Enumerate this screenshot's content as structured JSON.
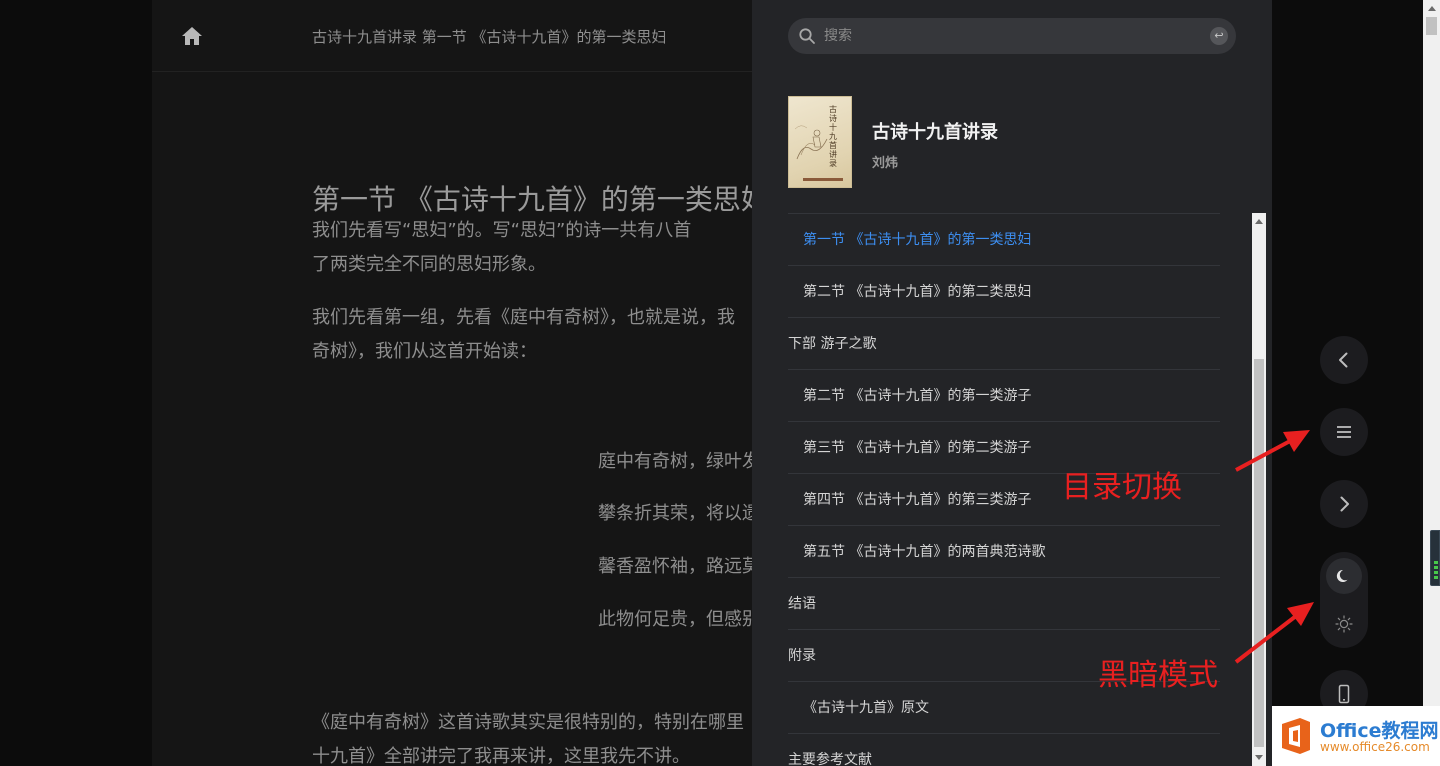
{
  "reader": {
    "breadcrumb": "古诗十九首讲录 第一节 《古诗十九首》的第一类思妇",
    "chapter_title": "第一节 《古诗十九首》的第一类思妇",
    "paragraphs": [
      "我们先看写“思妇”的。写“思妇”的诗一共有八首",
      "了两类完全不同的思妇形象。",
      "我们先看第一组，先看《庭中有奇树》，也就是说，我",
      "奇树》，我们从这首开始读："
    ],
    "poem_lines": [
      "庭中有奇树，绿叶发",
      "攀条折其荣，将以遗",
      "馨香盈怀袖，路远莫",
      "此物何足贵，但感别"
    ],
    "closing": [
      "《庭中有奇树》这首诗歌其实是很特别的，特别在哪里",
      "十九首》全部讲完了我再来讲，这里我先不讲。"
    ]
  },
  "drawer": {
    "search_placeholder": "搜索",
    "enter_glyph": "↩",
    "book": {
      "title": "古诗十九首讲录",
      "author": "刘炜",
      "cover_title": "古诗十九首讲录"
    },
    "toc": [
      {
        "label": "第一节 《古诗十九首》的第一类思妇",
        "level": 2,
        "active": true
      },
      {
        "label": "第二节 《古诗十九首》的第二类思妇",
        "level": 2,
        "active": false
      },
      {
        "label": "下部 游子之歌",
        "level": 1,
        "active": false
      },
      {
        "label": "第二节 《古诗十九首》的第一类游子",
        "level": 2,
        "active": false
      },
      {
        "label": "第三节 《古诗十九首》的第二类游子",
        "level": 2,
        "active": false
      },
      {
        "label": "第四节 《古诗十九首》的第三类游子",
        "level": 2,
        "active": false
      },
      {
        "label": "第五节 《古诗十九首》的两首典范诗歌",
        "level": 2,
        "active": false
      },
      {
        "label": "结语",
        "level": 1,
        "active": false
      },
      {
        "label": "附录",
        "level": 1,
        "active": false
      },
      {
        "label": "《古诗十九首》原文",
        "level": 2,
        "active": false
      },
      {
        "label": "主要参考文献",
        "level": 1,
        "active": false
      }
    ]
  },
  "controls": {
    "icons": [
      "prev-page-icon",
      "toc-toggle-icon",
      "next-page-icon",
      "dark-mode-moon-icon",
      "light-mode-sun-icon",
      "mobile-icon"
    ],
    "dark_mode": "on"
  },
  "annotations": {
    "toc_toggle": "目录切换",
    "dark_mode": "黑暗模式"
  },
  "watermark": {
    "brand": "Office教程网",
    "url": "www.office26.com"
  },
  "colors": {
    "accent": "#3d8ef0",
    "annotation": "#e82020",
    "drawer_bg": "#232427",
    "reader_bg": "#151515"
  }
}
